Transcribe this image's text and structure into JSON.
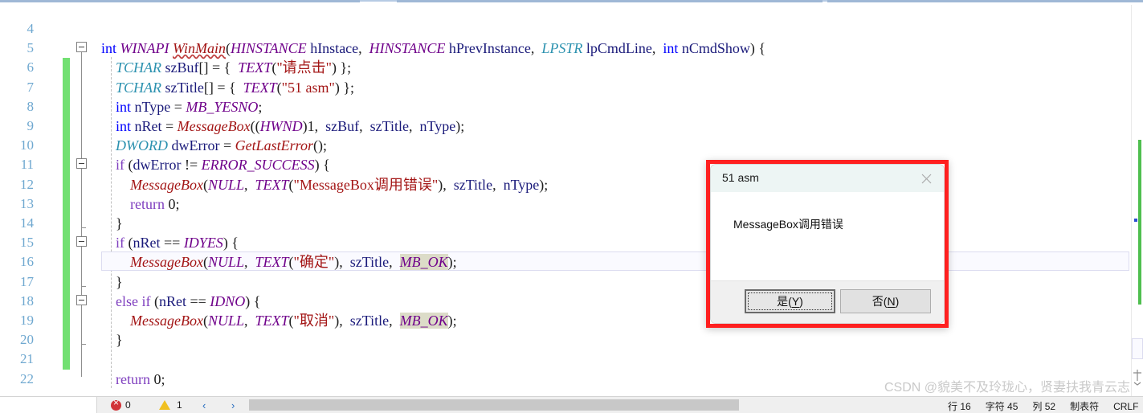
{
  "editor": {
    "first_line_number": 4,
    "last_line_number": 22,
    "current_line": 16,
    "line_numbers": [
      "4",
      "5",
      "6",
      "7",
      "8",
      "9",
      "10",
      "11",
      "12",
      "13",
      "14",
      "15",
      "16",
      "17",
      "18",
      "19",
      "20",
      "21",
      "22"
    ],
    "lines": [
      {
        "n": "4",
        "text": ""
      },
      {
        "n": "5",
        "text": "int WINAPI WinMain(HINSTANCE hInstace,  HINSTANCE hPrevInstance,  LPSTR lpCmdLine,  int nCmdShow) {"
      },
      {
        "n": "6",
        "text": "    TCHAR szBuf[] = {  TEXT(\"请点击\") };"
      },
      {
        "n": "7",
        "text": "    TCHAR szTitle[] = {  TEXT(\"51 asm\") };"
      },
      {
        "n": "8",
        "text": "    int nType = MB_YESNO;"
      },
      {
        "n": "9",
        "text": "    int nRet = MessageBox((HWND)1,  szBuf,  szTitle,  nType);"
      },
      {
        "n": "10",
        "text": "    DWORD dwError = GetLastError();"
      },
      {
        "n": "11",
        "text": "    if (dwError != ERROR_SUCCESS) {"
      },
      {
        "n": "12",
        "text": "        MessageBox(NULL,  TEXT(\"MessageBox调用错误\"),  szTitle,  nType);"
      },
      {
        "n": "13",
        "text": "        return 0;"
      },
      {
        "n": "14",
        "text": "    }"
      },
      {
        "n": "15",
        "text": "    if (nRet == IDYES) {"
      },
      {
        "n": "16",
        "text": "        MessageBox(NULL,  TEXT(\"确定\"),  szTitle,  MB_OK);"
      },
      {
        "n": "17",
        "text": "    }"
      },
      {
        "n": "18",
        "text": "    else if (nRet == IDNO) {"
      },
      {
        "n": "19",
        "text": "        MessageBox(NULL,  TEXT(\"取消\"),  szTitle,  MB_OK);"
      },
      {
        "n": "20",
        "text": "    }"
      },
      {
        "n": "21",
        "text": ""
      },
      {
        "n": "22",
        "text": "    return 0;"
      }
    ],
    "tokens": {
      "l5": [
        [
          "kw",
          "int"
        ],
        [
          "pl",
          " "
        ],
        [
          "mac",
          "WINAPI"
        ],
        [
          "pl",
          " "
        ],
        [
          "fn sq",
          "WinMain"
        ],
        [
          "pun",
          "("
        ],
        [
          "mac",
          "HINSTANCE"
        ],
        [
          "pl",
          " "
        ],
        [
          "id",
          "hInstace"
        ],
        [
          "pun",
          ","
        ],
        [
          "pl",
          "  "
        ],
        [
          "mac",
          "HINSTANCE"
        ],
        [
          "pl",
          " "
        ],
        [
          "id",
          "hPrevInstance"
        ],
        [
          "pun",
          ","
        ],
        [
          "pl",
          "  "
        ],
        [
          "ty",
          "LPSTR"
        ],
        [
          "pl",
          " "
        ],
        [
          "id",
          "lpCmdLine"
        ],
        [
          "pun",
          ","
        ],
        [
          "pl",
          "  "
        ],
        [
          "kw",
          "int"
        ],
        [
          "pl",
          " "
        ],
        [
          "id",
          "nCmdShow"
        ],
        [
          "pun",
          ")"
        ],
        [
          "pl",
          " "
        ],
        [
          "pun",
          "{"
        ]
      ],
      "l6": [
        [
          "pl",
          "    "
        ],
        [
          "ty",
          "TCHAR"
        ],
        [
          "pl",
          " "
        ],
        [
          "id",
          "szBuf"
        ],
        [
          "pun",
          "[] = {"
        ],
        [
          "pl",
          "  "
        ],
        [
          "mac",
          "TEXT"
        ],
        [
          "pun",
          "("
        ],
        [
          "str",
          "\"请点击\""
        ],
        [
          "pun",
          ") };"
        ]
      ],
      "l7": [
        [
          "pl",
          "    "
        ],
        [
          "ty",
          "TCHAR"
        ],
        [
          "pl",
          " "
        ],
        [
          "id",
          "szTitle"
        ],
        [
          "pun",
          "[] = {"
        ],
        [
          "pl",
          "  "
        ],
        [
          "mac",
          "TEXT"
        ],
        [
          "pun",
          "("
        ],
        [
          "str",
          "\"51 asm\""
        ],
        [
          "pun",
          ") };"
        ]
      ],
      "l8": [
        [
          "pl",
          "    "
        ],
        [
          "kw",
          "int"
        ],
        [
          "pl",
          " "
        ],
        [
          "id",
          "nType"
        ],
        [
          "pun",
          " = "
        ],
        [
          "mac",
          "MB_YESNO"
        ],
        [
          "pun",
          ";"
        ]
      ],
      "l9": [
        [
          "pl",
          "    "
        ],
        [
          "kw",
          "int"
        ],
        [
          "pl",
          " "
        ],
        [
          "id",
          "nRet"
        ],
        [
          "pun",
          " = "
        ],
        [
          "fn",
          "MessageBox"
        ],
        [
          "pun",
          "(("
        ],
        [
          "mac",
          "HWND"
        ],
        [
          "pun",
          ")"
        ],
        [
          "num",
          "1"
        ],
        [
          "pun",
          ","
        ],
        [
          "pl",
          "  "
        ],
        [
          "id",
          "szBuf"
        ],
        [
          "pun",
          ","
        ],
        [
          "pl",
          "  "
        ],
        [
          "id",
          "szTitle"
        ],
        [
          "pun",
          ","
        ],
        [
          "pl",
          "  "
        ],
        [
          "id",
          "nType"
        ],
        [
          "pun",
          ");"
        ]
      ],
      "l10": [
        [
          "pl",
          "    "
        ],
        [
          "ty",
          "DWORD"
        ],
        [
          "pl",
          " "
        ],
        [
          "id",
          "dwError"
        ],
        [
          "pun",
          " = "
        ],
        [
          "fn",
          "GetLastError"
        ],
        [
          "pun",
          "();"
        ]
      ],
      "l11": [
        [
          "pl",
          "    "
        ],
        [
          "kw2",
          "if"
        ],
        [
          "pl",
          " "
        ],
        [
          "pun",
          "("
        ],
        [
          "id",
          "dwError"
        ],
        [
          "pun",
          " != "
        ],
        [
          "mac",
          "ERROR_SUCCESS"
        ],
        [
          "pun",
          ") {"
        ]
      ],
      "l12": [
        [
          "pl",
          "        "
        ],
        [
          "fn",
          "MessageBox"
        ],
        [
          "pun",
          "("
        ],
        [
          "mac",
          "NULL"
        ],
        [
          "pun",
          ","
        ],
        [
          "pl",
          "  "
        ],
        [
          "mac",
          "TEXT"
        ],
        [
          "pun",
          "("
        ],
        [
          "str",
          "\"MessageBox调用错误\""
        ],
        [
          "pun",
          "),"
        ],
        [
          "pl",
          "  "
        ],
        [
          "id",
          "szTitle"
        ],
        [
          "pun",
          ","
        ],
        [
          "pl",
          "  "
        ],
        [
          "id",
          "nType"
        ],
        [
          "pun",
          ");"
        ]
      ],
      "l13": [
        [
          "pl",
          "        "
        ],
        [
          "kw2",
          "return"
        ],
        [
          "pl",
          " "
        ],
        [
          "num",
          "0"
        ],
        [
          "pun",
          ";"
        ]
      ],
      "l14": [
        [
          "pl",
          "    "
        ],
        [
          "pun",
          "}"
        ]
      ],
      "l15": [
        [
          "pl",
          "    "
        ],
        [
          "kw2",
          "if"
        ],
        [
          "pl",
          " "
        ],
        [
          "pun",
          "("
        ],
        [
          "id",
          "nRet"
        ],
        [
          "pun",
          " == "
        ],
        [
          "mac",
          "IDYES"
        ],
        [
          "pun",
          ") {"
        ]
      ],
      "l16": [
        [
          "pl",
          "        "
        ],
        [
          "fn",
          "MessageBox"
        ],
        [
          "pun",
          "("
        ],
        [
          "mac",
          "NULL"
        ],
        [
          "pun",
          ","
        ],
        [
          "pl",
          "  "
        ],
        [
          "mac",
          "TEXT"
        ],
        [
          "pun",
          "("
        ],
        [
          "str",
          "\"确定\""
        ],
        [
          "pun",
          "),"
        ],
        [
          "pl",
          "  "
        ],
        [
          "id",
          "szTitle"
        ],
        [
          "pun",
          ","
        ],
        [
          "pl",
          "  "
        ],
        [
          "mac hl",
          "MB_OK"
        ],
        [
          "pun",
          ");"
        ]
      ],
      "l17": [
        [
          "pl",
          "    "
        ],
        [
          "pun",
          "}"
        ]
      ],
      "l18": [
        [
          "pl",
          "    "
        ],
        [
          "kw2",
          "else"
        ],
        [
          "pl",
          " "
        ],
        [
          "kw2",
          "if"
        ],
        [
          "pl",
          " "
        ],
        [
          "pun",
          "("
        ],
        [
          "id",
          "nRet"
        ],
        [
          "pun",
          " == "
        ],
        [
          "mac",
          "IDNO"
        ],
        [
          "pun",
          ") {"
        ]
      ],
      "l19": [
        [
          "pl",
          "        "
        ],
        [
          "fn",
          "MessageBox"
        ],
        [
          "pun",
          "("
        ],
        [
          "mac",
          "NULL"
        ],
        [
          "pun",
          ","
        ],
        [
          "pl",
          "  "
        ],
        [
          "mac",
          "TEXT"
        ],
        [
          "pun",
          "("
        ],
        [
          "str",
          "\"取消\""
        ],
        [
          "pun",
          "),"
        ],
        [
          "pl",
          "  "
        ],
        [
          "id",
          "szTitle"
        ],
        [
          "pun",
          ","
        ],
        [
          "pl",
          "  "
        ],
        [
          "mac hl",
          "MB_OK"
        ],
        [
          "pun",
          ");"
        ]
      ],
      "l20": [
        [
          "pl",
          "    "
        ],
        [
          "pun",
          "}"
        ]
      ],
      "l21": [
        [
          "pl",
          ""
        ]
      ],
      "l22": [
        [
          "pl",
          "    "
        ],
        [
          "kw2",
          "return"
        ],
        [
          "pl",
          " "
        ],
        [
          "num",
          "0"
        ],
        [
          "pun",
          ";"
        ]
      ]
    },
    "fold_markers": [
      5,
      11,
      15,
      18
    ],
    "colors": {
      "line_number": "#6fa8d0",
      "change_bar": "#72e072",
      "keyword": "#0000ff",
      "control_keyword": "#7f3fbf",
      "type": "#2b91af",
      "macro": "#6f008a",
      "function": "#a31515",
      "string": "#a31515",
      "identifier": "#1a1a7a",
      "highlight": "#dcdcc8",
      "current_line_bg": "#fafaff"
    }
  },
  "dialog": {
    "title": "51 asm",
    "message": "MessageBox调用错误",
    "close_icon": "close-icon",
    "buttons": [
      {
        "label": "是(Y)",
        "mnemonic": "Y",
        "text_before": "是(",
        "text_after": ")",
        "default": true
      },
      {
        "label": "否(N)",
        "mnemonic": "N",
        "text_before": "否(",
        "text_after": ")",
        "default": false
      }
    ],
    "highlight_border_color": "#ff2020",
    "titlebar_color": "#edf5f4"
  },
  "statusbar": {
    "error_count": "0",
    "warning_count": "1",
    "prev_label": "‹",
    "next_label": "›",
    "right_items": [
      "行 16",
      "字符 45",
      "列 52",
      "制表符",
      "CRLF"
    ]
  },
  "watermark": {
    "text": "CSDN @貌美不及玲珑心，贤妻扶我青云志"
  }
}
